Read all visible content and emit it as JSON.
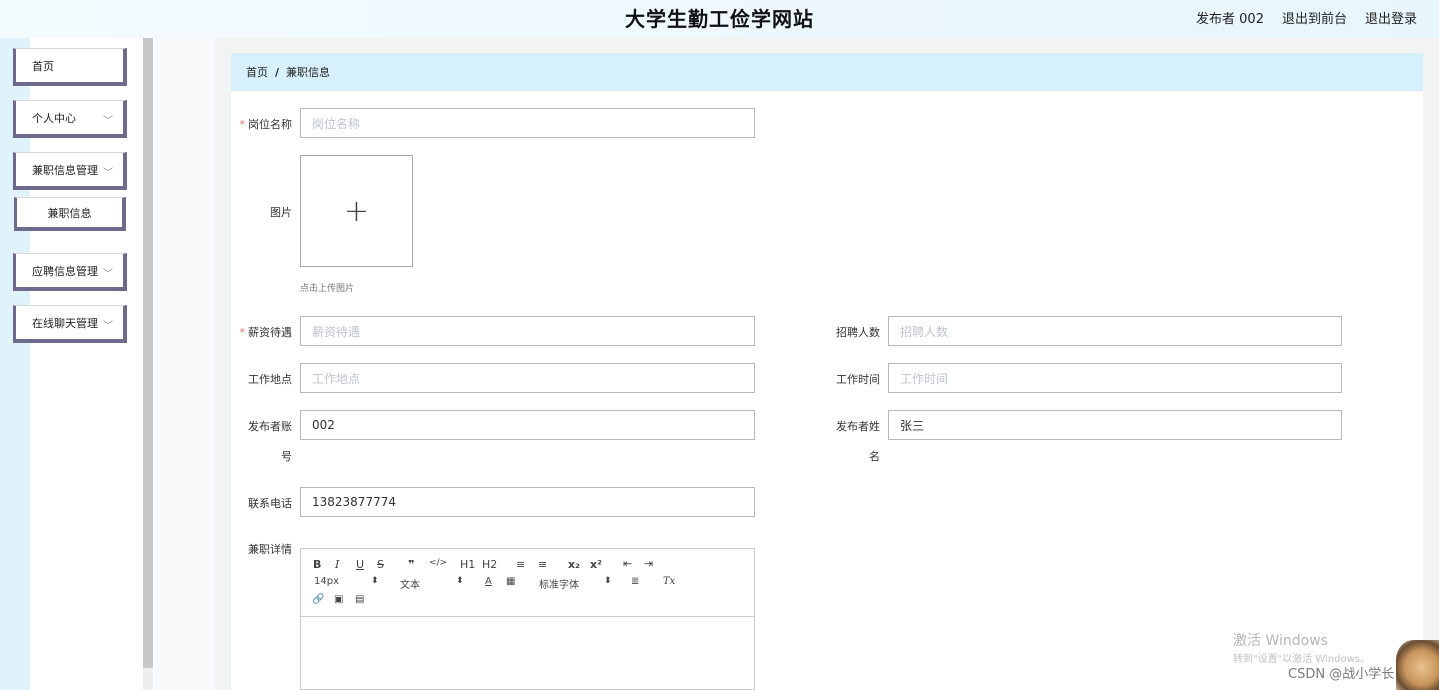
{
  "header": {
    "title": "大学生勤工俭学网站",
    "user": "发布者 002",
    "to_front": "退出到前台",
    "logout": "退出登录"
  },
  "sidebar": {
    "items": [
      {
        "label": "首页"
      },
      {
        "label": "个人中心"
      },
      {
        "label": "兼职信息管理"
      },
      {
        "label": "兼职信息"
      },
      {
        "label": "应聘信息管理"
      },
      {
        "label": "在线聊天管理"
      }
    ]
  },
  "breadcrumb": {
    "home": "首页",
    "sep": "/",
    "current": "兼职信息"
  },
  "form": {
    "job_name": {
      "label": "岗位名称",
      "placeholder": "岗位名称"
    },
    "image": {
      "label": "图片",
      "hint": "点击上传图片"
    },
    "salary": {
      "label": "薪资待遇",
      "placeholder": "薪资待遇"
    },
    "recruit_count": {
      "label": "招聘人数",
      "placeholder": "招聘人数"
    },
    "location": {
      "label": "工作地点",
      "placeholder": "工作地点"
    },
    "work_time": {
      "label": "工作时间",
      "placeholder": "工作时间"
    },
    "publisher_account": {
      "label_l1": "发布者账",
      "label_l2": "号",
      "value": "002"
    },
    "publisher_name": {
      "label_l1": "发布者姓",
      "label_l2": "名",
      "value": "张三"
    },
    "phone": {
      "label": "联系电话",
      "value": "13823877774"
    },
    "details": {
      "label": "兼职详情"
    }
  },
  "editor": {
    "font_size": "14px",
    "paragraph": "文本",
    "font_family": "标准字体",
    "buttons": [
      "B",
      "I",
      "U",
      "S",
      "❞",
      "</>",
      "H1",
      "H2",
      "≡",
      "≡",
      "x₂",
      "x²",
      "⇤",
      "⇥",
      "A",
      "▦",
      "≣",
      "Tx",
      "🔗",
      "▣",
      "▤"
    ]
  },
  "watermark": {
    "activate": "激活 Windows",
    "goto": "转到\"设置\"以激活 Windows。",
    "csdn": "CSDN @战小学长"
  }
}
